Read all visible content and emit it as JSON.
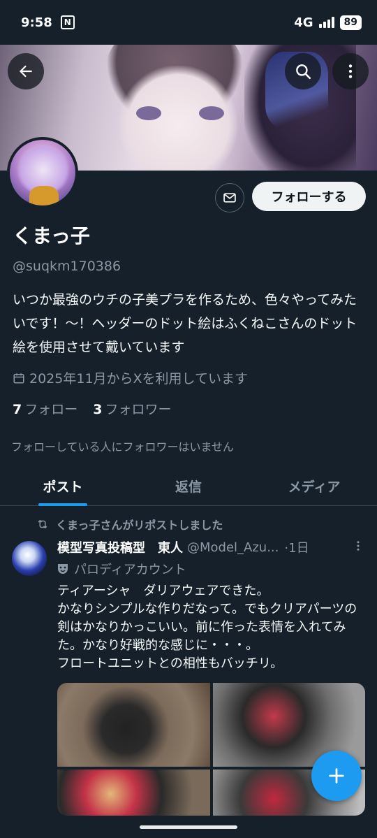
{
  "status_bar": {
    "time": "9:58",
    "network": "4G",
    "battery": "89"
  },
  "profile": {
    "name": "くまっ子",
    "handle": "@suqkm170386",
    "bio": "いつか最強のウチの子美プラを作るため、色々やってみたいです！〜！ヘッダーのドット絵はふくねこさんのドット絵を使用させて戴いています",
    "joined": "2025年11月からXを利用しています",
    "following_count": "7",
    "following_label": "フォロー",
    "followers_count": "3",
    "followers_label": "フォロワー",
    "no_mutual_followers": "フォローしている人にフォロワーはいません",
    "follow_button": "フォローする"
  },
  "tabs": [
    {
      "label": "ポスト",
      "active": true
    },
    {
      "label": "返信",
      "active": false
    },
    {
      "label": "メディア",
      "active": false
    }
  ],
  "post": {
    "repost_label": "くまっ子さんがリポストしました",
    "author": "模型写真投稿型　東人",
    "username": "@Model_Azu...",
    "time": "·1日",
    "parody_label": "パロディアカウント",
    "text": "ティアーシャ　ダリアウェアできた。\nかなりシンプルな作りだなって。でもクリアパーツの剣はかなりかっこいい。前に作った表情を入れてみた。かなり好戦的な感じに・・・。\nフロートユニットとの相性もバッチリ。"
  },
  "colors": {
    "background": "#15202b",
    "accent": "#1d9bf0",
    "secondary_text": "#8b98a5"
  },
  "icons": {
    "back": "arrow-left-icon",
    "search": "search-icon",
    "more": "more-vertical-icon",
    "mail": "mail-icon",
    "calendar": "calendar-icon",
    "repost": "repost-icon",
    "parody": "parody-mask-icon",
    "compose": "plus-icon"
  }
}
